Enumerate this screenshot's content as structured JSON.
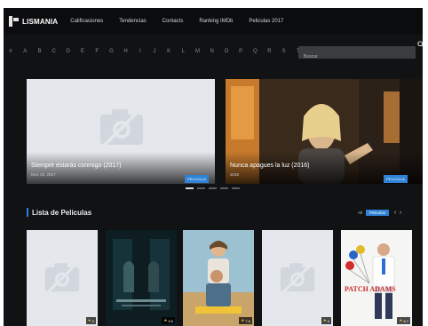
{
  "logo": {
    "text": "LISMANIA"
  },
  "nav": [
    "Calificaciones",
    "Tendencias",
    "Contacts",
    "Ranking IMDb",
    "Peliculas 2017"
  ],
  "alphabet": [
    "#",
    "A",
    "B",
    "C",
    "D",
    "E",
    "F",
    "G",
    "H",
    "I",
    "J",
    "K",
    "L",
    "M",
    "N",
    "O",
    "P",
    "Q",
    "R",
    "S",
    "T",
    "U",
    "V",
    "W",
    "X",
    "Y",
    "Z"
  ],
  "search": {
    "placeholder": "Buscar"
  },
  "slides": [
    {
      "title": "Siempre estarás conmigo (2017)",
      "date": "Nov. 23, 2017",
      "badge": "PELICULA"
    },
    {
      "title": "Nunca apagues la luz (2016)",
      "date": "2016",
      "badge": "PELICULA"
    }
  ],
  "slider_dots": {
    "count": 5,
    "active": 0
  },
  "section": {
    "title": "Lista de Peliculas"
  },
  "filters": [
    {
      "label": "All",
      "active": false
    },
    {
      "label": "Peliculas",
      "active": true
    }
  ],
  "posters": [
    {
      "rating": "0",
      "kind": "placeholder"
    },
    {
      "rating": "9.0",
      "kind": "dark"
    },
    {
      "rating": "7.6",
      "kind": "family"
    },
    {
      "rating": "0",
      "kind": "placeholder"
    },
    {
      "rating": "6.7",
      "kind": "patch",
      "poster_text": "PATCH ADAMS"
    }
  ],
  "colors": {
    "accent": "#2f82d6",
    "background": "#111214",
    "topbar": "#0b0c0e",
    "placeholder": "#e4e7ec",
    "star": "#f2c230"
  }
}
